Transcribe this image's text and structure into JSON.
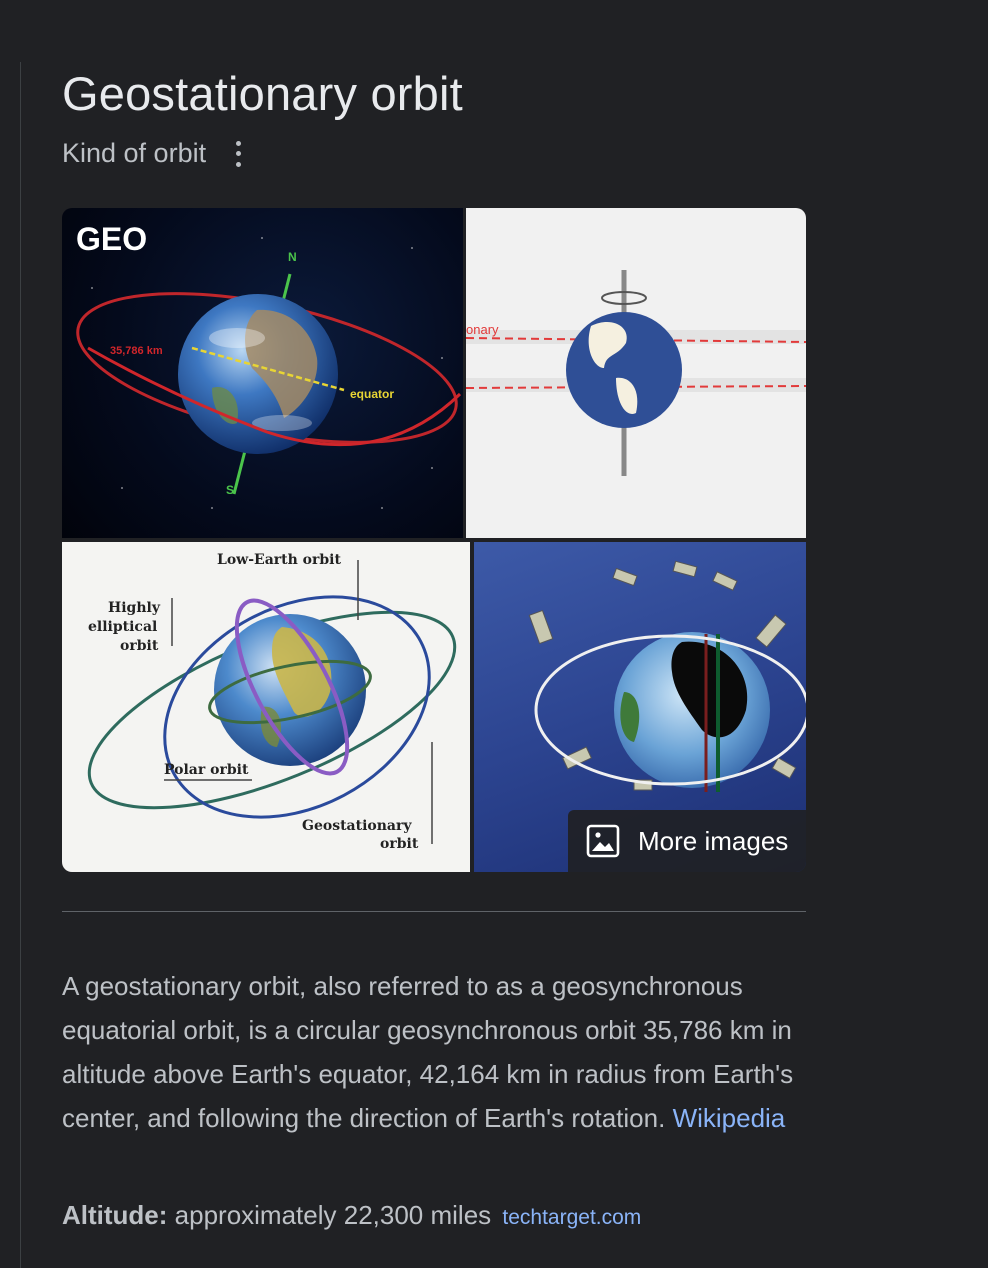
{
  "entity": {
    "title": "Geostationary orbit",
    "subtitle": "Kind of orbit",
    "menu_icon": "more-vert-icon"
  },
  "images": {
    "tiles": [
      {
        "top_label": "GEO",
        "distance_label": "35,786 km",
        "axis_north": "N",
        "axis_south": "S",
        "equator_label": "equator"
      },
      {
        "partial_label": "onary"
      },
      {
        "label_leo": "Low-Earth orbit",
        "label_heo_1": "Highly",
        "label_heo_2": "elliptical",
        "label_heo_3": "orbit",
        "label_polar": "Polar orbit",
        "label_geo_1": "Geostationary",
        "label_geo_2": "orbit"
      },
      {}
    ],
    "more_images_label": "More images",
    "more_images_icon": "image-icon"
  },
  "description": {
    "text": "A geostationary orbit, also referred to as a geosynchronous equatorial orbit, is a circular geosynchronous orbit 35,786 km in altitude above Earth's equator, 42,164 km in radius from Earth's center, and following the direction of Earth's rotation.",
    "source_label": "Wikipedia"
  },
  "facts": [
    {
      "label": "Altitude:",
      "value": "approximately 22,300 miles",
      "source": "techtarget.com"
    }
  ],
  "colors": {
    "background": "#202124",
    "title": "#e8eaed",
    "secondary_text": "#bdc1c6",
    "link": "#8ab4f8",
    "divider": "#5f6368"
  }
}
